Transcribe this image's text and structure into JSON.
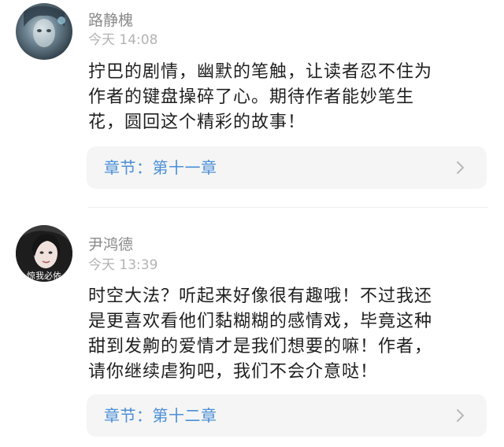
{
  "comments": [
    {
      "username": "路静槐",
      "time": "今天 14:08",
      "lines": [
        "拧巴的剧情，幽默的笔触，让读者忍不住为",
        "作者的键盘操碎了心。期待作者能妙笔生",
        "花，圆回这个精彩的故事！"
      ],
      "chapter": "章节：第十一章"
    },
    {
      "username": "尹鸿德",
      "time": "今天 13:39",
      "avatar_caption": "惊我必依",
      "lines": [
        "时空大法？听起来好像很有趣哦！不过我还",
        "是更喜欢看他们黏糊糊的感情戏，毕竟这种",
        "甜到发齁的爱情才是我们想要的嘛！作者，",
        "请你继续虐狗吧，我们不会介意哒！"
      ],
      "chapter": "章节：第十二章"
    }
  ],
  "colors": {
    "link": "#4a8fd8",
    "username": "#8a8a8a",
    "timestamp": "#b3b3b3",
    "card_bg": "#f5f5f5"
  },
  "icons": {
    "chevron": "chevron-right-icon"
  }
}
